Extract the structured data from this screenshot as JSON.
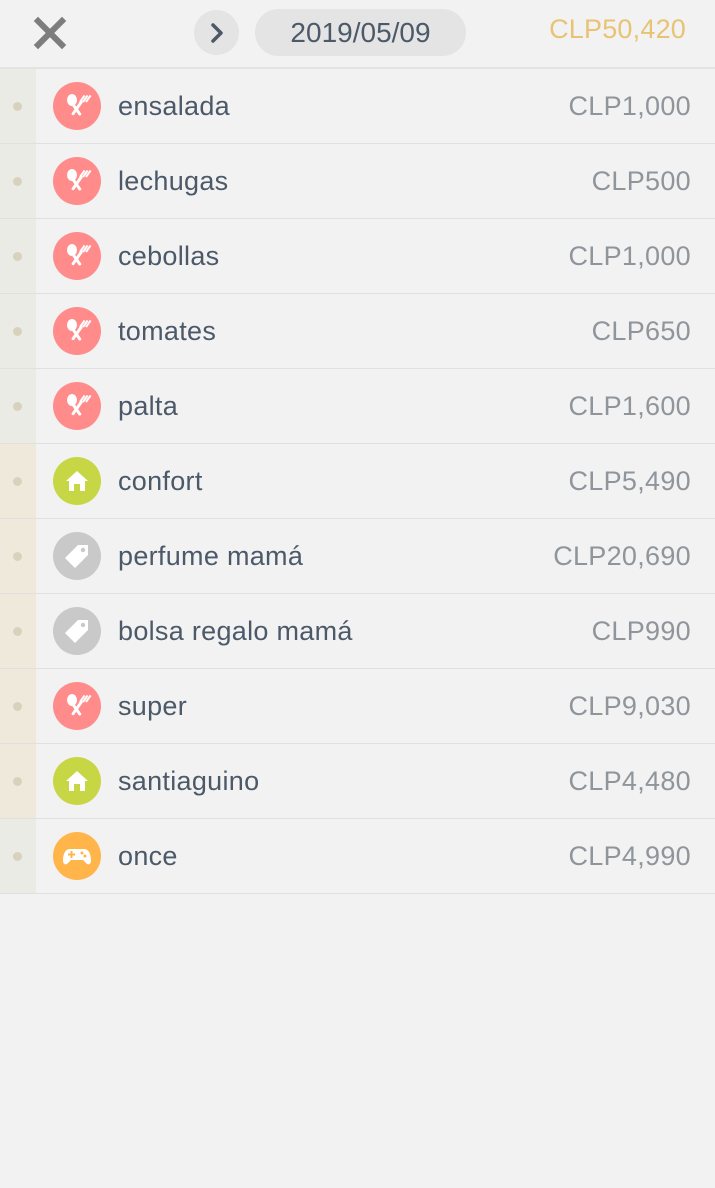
{
  "header": {
    "date": "2019/05/09",
    "total": "CLP50,420"
  },
  "colors": {
    "food": "#ff8b8b",
    "home": "#c7d645",
    "gift": "#c9c9c9",
    "entertainment": "#ffb54a",
    "stripe_a": "#ebebe5",
    "stripe_b": "#efe9db",
    "total": "#e8c374"
  },
  "items": [
    {
      "name": "ensalada",
      "amount": "CLP1,000",
      "icon": "fork-spoon-icon",
      "color": "food",
      "stripe": "stripe_a"
    },
    {
      "name": "lechugas",
      "amount": "CLP500",
      "icon": "fork-spoon-icon",
      "color": "food",
      "stripe": "stripe_a"
    },
    {
      "name": "cebollas",
      "amount": "CLP1,000",
      "icon": "fork-spoon-icon",
      "color": "food",
      "stripe": "stripe_a"
    },
    {
      "name": "tomates",
      "amount": "CLP650",
      "icon": "fork-spoon-icon",
      "color": "food",
      "stripe": "stripe_a"
    },
    {
      "name": "palta",
      "amount": "CLP1,600",
      "icon": "fork-spoon-icon",
      "color": "food",
      "stripe": "stripe_a"
    },
    {
      "name": "confort",
      "amount": "CLP5,490",
      "icon": "house-icon",
      "color": "home",
      "stripe": "stripe_b"
    },
    {
      "name": "perfume mamá",
      "amount": "CLP20,690",
      "icon": "tag-icon",
      "color": "gift",
      "stripe": "stripe_b"
    },
    {
      "name": "bolsa regalo mamá",
      "amount": "CLP990",
      "icon": "tag-icon",
      "color": "gift",
      "stripe": "stripe_b"
    },
    {
      "name": "super",
      "amount": "CLP9,030",
      "icon": "fork-spoon-icon",
      "color": "food",
      "stripe": "stripe_b"
    },
    {
      "name": "santiaguino",
      "amount": "CLP4,480",
      "icon": "house-icon",
      "color": "home",
      "stripe": "stripe_b"
    },
    {
      "name": "once",
      "amount": "CLP4,990",
      "icon": "gamepad-icon",
      "color": "entertainment",
      "stripe": "stripe_a"
    }
  ]
}
